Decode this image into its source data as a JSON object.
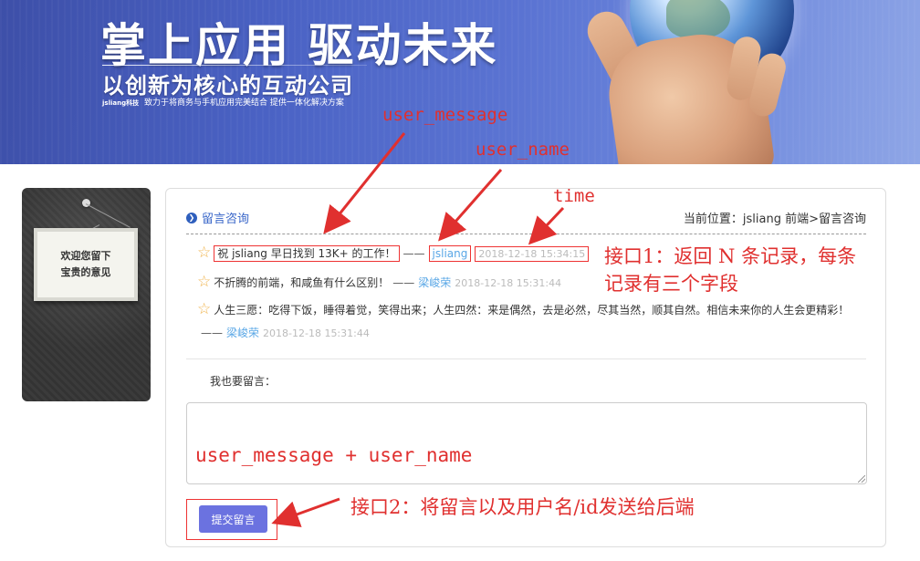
{
  "banner": {
    "title": "掌上应用 驱动未来",
    "subtitle": "以创新为核心的互动公司",
    "brand": "jsliang科技",
    "tagline": "致力于将商务与手机应用完美结合 提供一体化解决方案"
  },
  "sidebar": {
    "board_line1": "欢迎您留下",
    "board_line2": "宝贵的意见"
  },
  "panel": {
    "title": "留言咨询",
    "breadcrumb": "当前位置：jsliang 前端>留言咨询",
    "messages": [
      {
        "text": "祝 jsliang 早日找到 13K+ 的工作！",
        "dash": "——",
        "user": "jsliang",
        "time": "2018-12-18 15:34:15"
      },
      {
        "text": "不折腾的前端，和咸鱼有什么区别！",
        "dash": "——",
        "user": "梁峻荣",
        "time": "2018-12-18 15:31:44"
      },
      {
        "text": "人生三愿：吃得下饭，睡得着觉，笑得出来；人生四然：来是偶然，去是必然，尽其当然，顺其自然。相信未来你的人生会更精彩！",
        "dash": "——",
        "user": "梁峻荣",
        "time": "2018-12-18 15:31:44"
      }
    ],
    "leave_label": "我也要留言：",
    "textarea_value": "",
    "submit_label": "提交留言"
  },
  "annotations": {
    "user_message": "user_message",
    "user_name": "user_name",
    "time": "time",
    "api1_line1": "接口1：返回 N 条记录，每条",
    "api1_line2": "记录有三个字段",
    "textarea_note": "user_message + user_name",
    "api2": "接口2：将留言以及用户名/id发送给后端"
  },
  "colors": {
    "accent": "#6b72e0",
    "link": "#5aa7e6",
    "annotation": "#e0302f",
    "title": "#3a67c9"
  }
}
